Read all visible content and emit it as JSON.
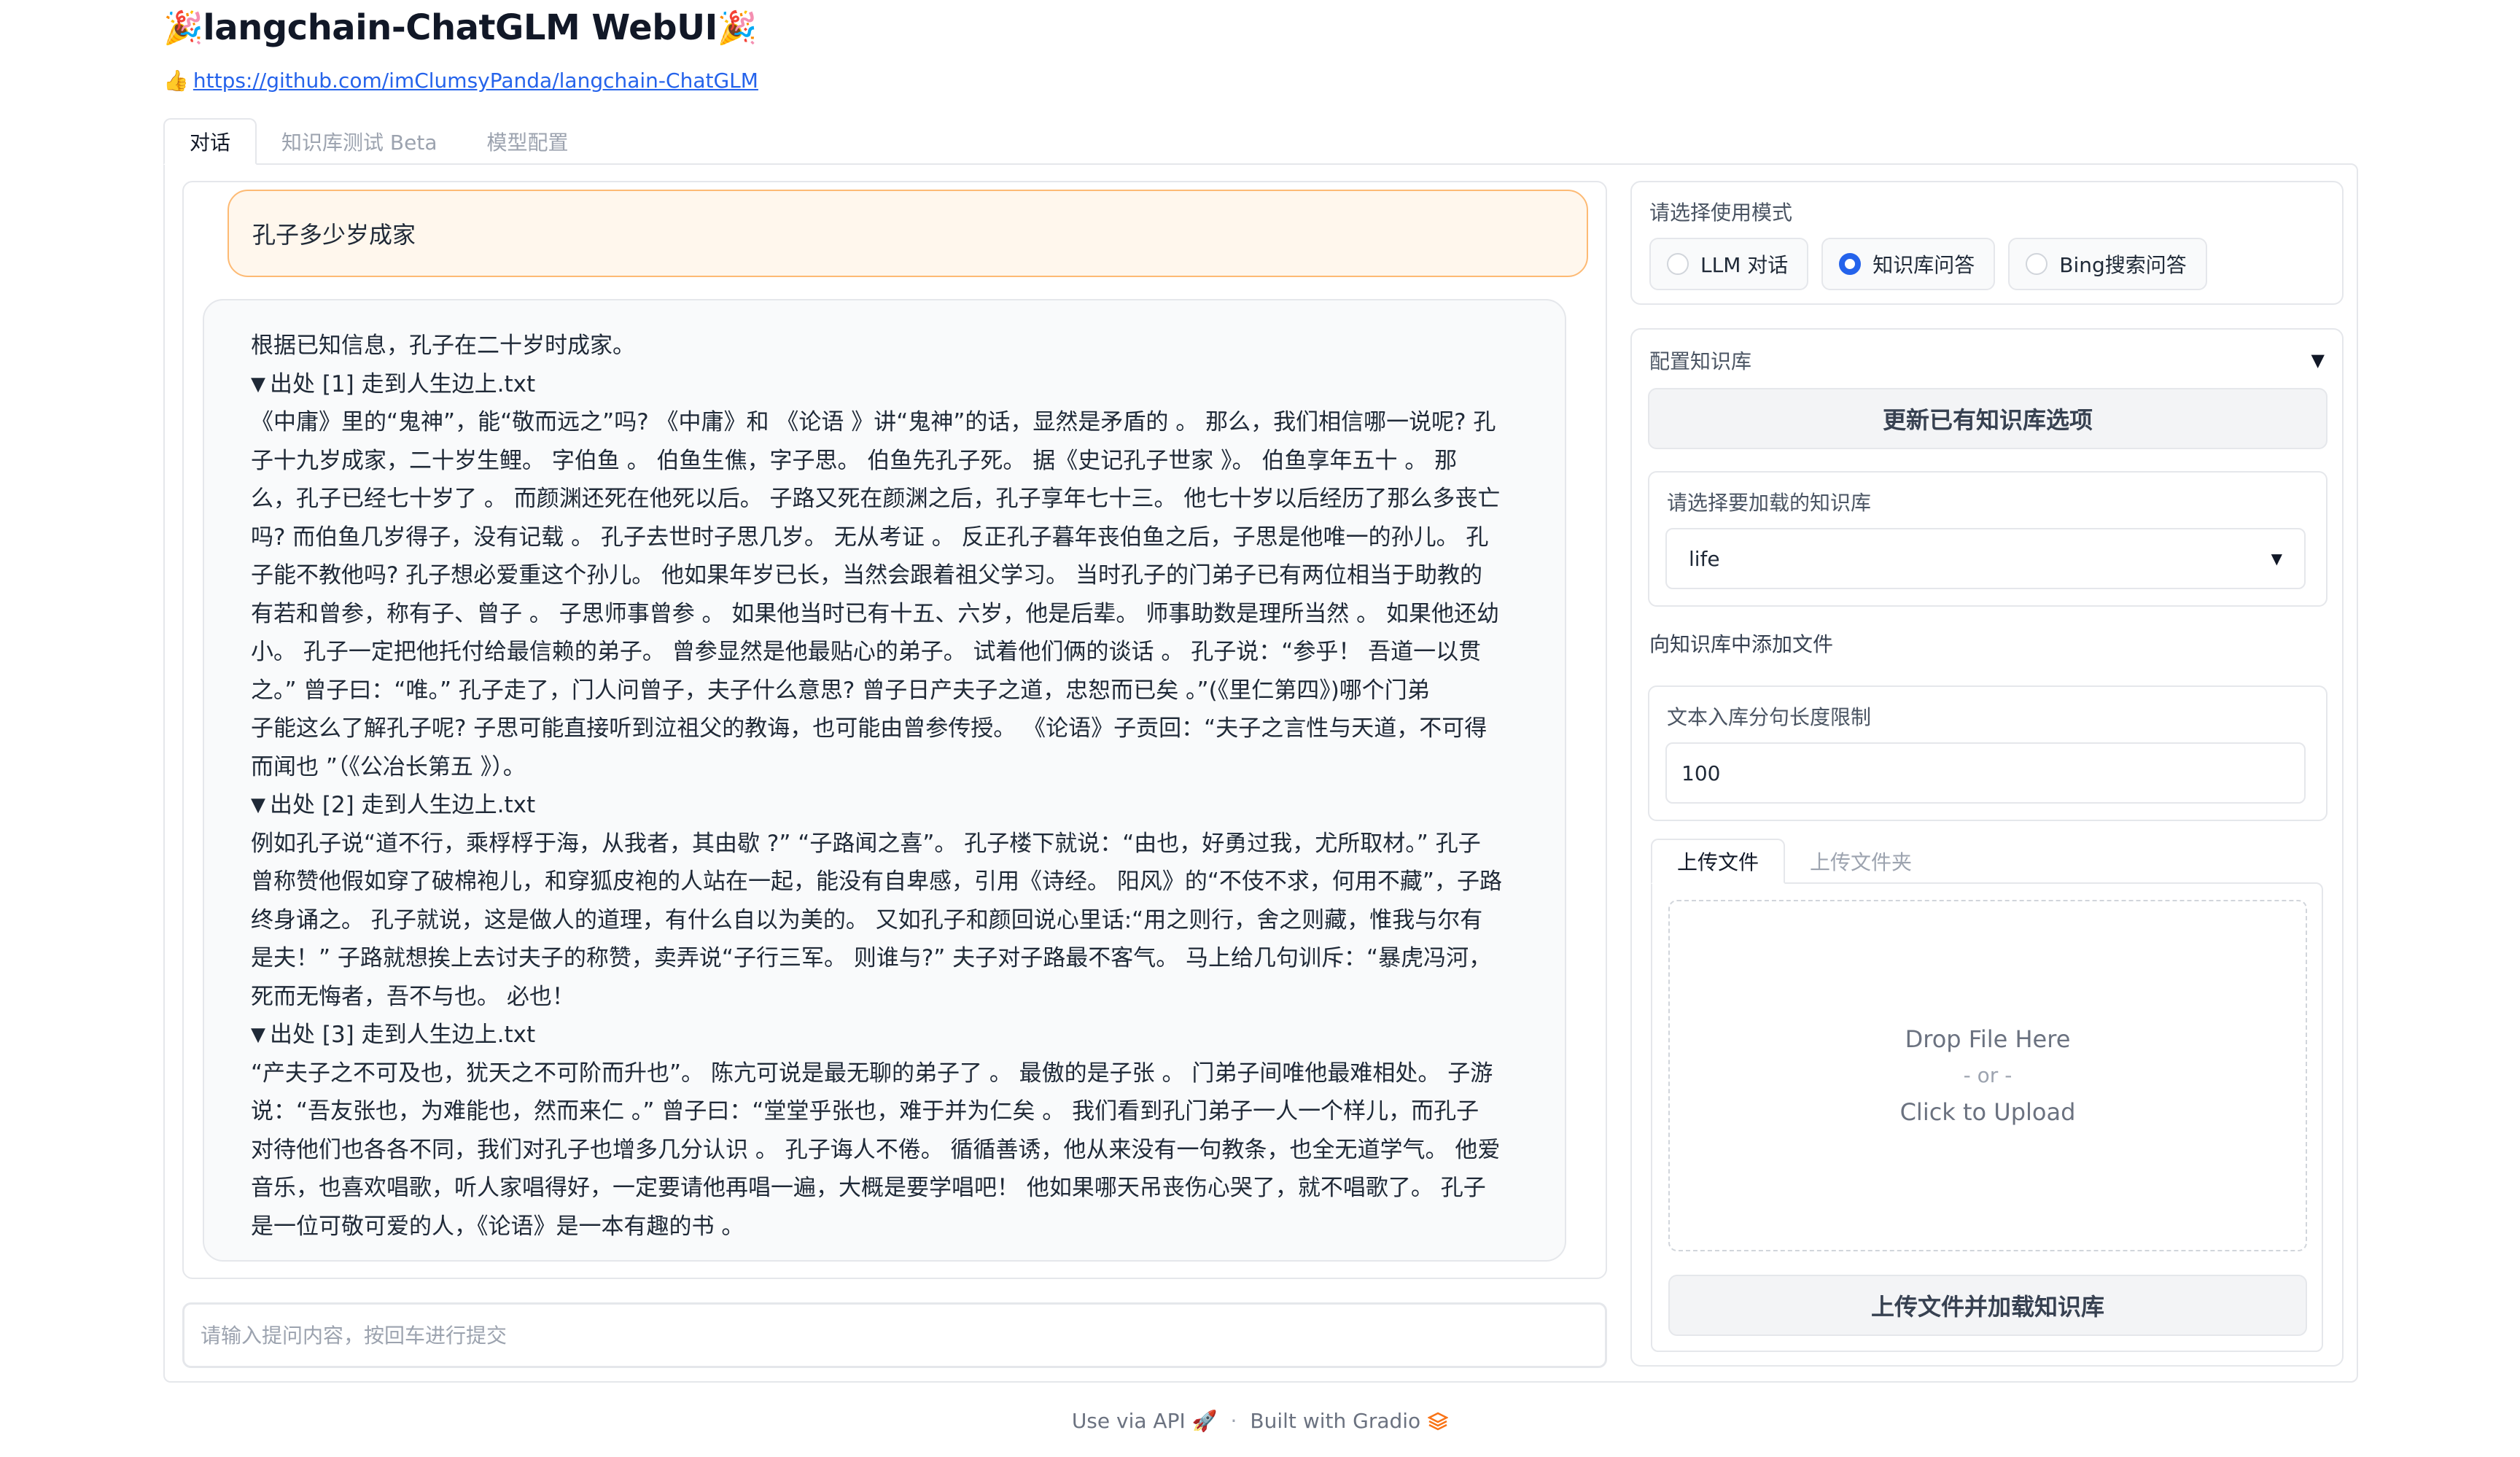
{
  "app": {
    "title": "langchain-ChatGLM WebUI",
    "title_emoji": "🎉",
    "repo_emoji": "👍",
    "repo_link": "https://github.com/imClumsyPanda/langchain-ChatGLM"
  },
  "tabs": [
    {
      "label": "对话",
      "active": true
    },
    {
      "label": "知识库测试 Beta",
      "active": false
    },
    {
      "label": "模型配置",
      "active": false
    }
  ],
  "chat": {
    "user_message": "孔子多少岁成家",
    "bot_answer": "根据已知信息，孔子在二十岁时成家。",
    "sources": [
      {
        "triangle": "▼",
        "title": "出处 [1] 走到人生边上.txt",
        "lines": [
          "《中庸》里的“鬼神”，能“敬而远之”吗? 《中庸》和 《论语 》讲“鬼神”的话，显然是矛盾的 。 那么，我们相信哪一说呢? 孔",
          "子十九岁成家，二十岁生鲤。 字伯鱼 。 伯鱼生僬，字子思。 伯鱼先孔子死。 据《史记孔子世家 》。 伯鱼享年五十 。 那",
          "么，孔子已经七十岁了 。 而颜渊还死在他死以后。 子路又死在颜渊之后，孔子享年七十三。 他七十岁以后经历了那么多丧亡",
          "吗? 而伯鱼几岁得子，没有记载 。 孔子去世时子思几岁。 无从考证 。 反正孔子暮年丧伯鱼之后，子思是他唯一的孙儿。 孔",
          "子能不教他吗? 孔子想必爱重这个孙儿。 他如果年岁已长，当然会跟着祖父学习。 当时孔子的门弟子已有两位相当于助教的",
          "有若和曾参，称有子、曾子 。 子思师事曾参 。 如果他当时已有十五、六岁，他是后辈。 师事助数是理所当然 。 如果他还幼",
          "小。 孔子一定把他托付给最信赖的弟子。 曾参显然是他最贴心的弟子。 试着他们俩的谈话 。 孔子说：“参乎！ 吾道一以贯",
          "之。” 曾子曰：“唯。” 孔子走了，门人问曾子，夫子什么意思? 曾子日产夫子之道，忠恕而已矣 。”(《里仁第四》)哪个门弟",
          "子能这么了解孔子呢? 子思可能直接听到泣祖父的教诲，也可能由曾参传授。 《论语》子贡回：“夫子之言性与天道，不可得",
          "而闻也 ”（《公冶长第五 》）。"
        ]
      },
      {
        "triangle": "▼",
        "title": "出处 [2] 走到人生边上.txt",
        "lines": [
          "例如孔子说“道不行，乘桴桴于海，从我者，其由歇 ?” “子路闻之喜”。 孔子楼下就说：“由也，好勇过我，尤所取材。” 孔子",
          "曾称赞他假如穿了破棉袍儿，和穿狐皮袍的人站在一起，能没有自卑感，引用《诗经。 阳风》的“不伎不求，何用不藏”，子路",
          "终身诵之。 孔子就说，这是做人的道理，有什么自以为美的。 又如孔子和颜回说心里话:“用之则行，舍之则藏，惟我与尔有",
          "是夫！” 子路就想挨上去讨夫子的称赞，卖弄说“子行三军。 则谁与?” 夫子对子路最不客气。 马上给几句训斥：“暴虎冯河，",
          "死而无悔者，吾不与也。 必也！"
        ]
      },
      {
        "triangle": "▼",
        "title": "出处 [3] 走到人生边上.txt",
        "lines": [
          "“产夫子之不可及也，犹天之不可阶而升也”。 陈亢可说是最无聊的弟子了 。 最傲的是子张 。 门弟子间唯他最难相处。 子游",
          "说：“吾友张也，为难能也，然而来仁 。” 曾子曰：“堂堂乎张也，难于并为仁矣 。 我们看到孔门弟子一人一个样儿，而孔子",
          "对待他们也各各不同，我们对孔子也增多几分认识 。 孔子诲人不倦。 循循善诱，他从来没有一句教条，也全无道学气。 他爱",
          "音乐，也喜欢唱歌，听人家唱得好，一定要请他再唱一遍，大概是要学唱吧！ 他如果哪天吊丧伤心哭了，就不唱歌了。 孔子",
          "是一位可敬可爱的人，《论语》是一本有趣的书 。"
        ]
      }
    ]
  },
  "question_input": {
    "placeholder": "请输入提问内容，按回车进行提交",
    "value": ""
  },
  "mode": {
    "label": "请选择使用模式",
    "options": [
      {
        "label": "LLM 对话",
        "checked": false
      },
      {
        "label": "知识库问答",
        "checked": true
      },
      {
        "label": "Bing搜索问答",
        "checked": false
      }
    ]
  },
  "kb": {
    "accordion_label": "配置知识库",
    "accordion_caret": "▼",
    "refresh_button": "更新已有知识库选项",
    "select_label": "请选择要加载的知识库",
    "select_value": "life",
    "add_files_label": "向知识库中添加文件",
    "sentence_limit_label": "文本入库分句长度限制",
    "sentence_limit_value": "100",
    "upload_tabs": [
      {
        "label": "上传文件",
        "active": true
      },
      {
        "label": "上传文件夹",
        "active": false
      }
    ],
    "dropzone": {
      "line1": "Drop File Here",
      "line2": "- or -",
      "line3": "Click to Upload"
    },
    "upload_button": "上传文件并加载知识库"
  },
  "footer": {
    "api_label": "Use via API",
    "api_emoji": "🚀",
    "separator": "·",
    "built_label": "Built with Gradio"
  },
  "colors": {
    "accent": "#2563eb",
    "user_bubble_bg": "#fff7ed",
    "user_bubble_border": "#fdba74",
    "bot_bubble_bg": "#f9fafb",
    "border": "#e5e7eb",
    "gradio_logo": "#f97316"
  }
}
